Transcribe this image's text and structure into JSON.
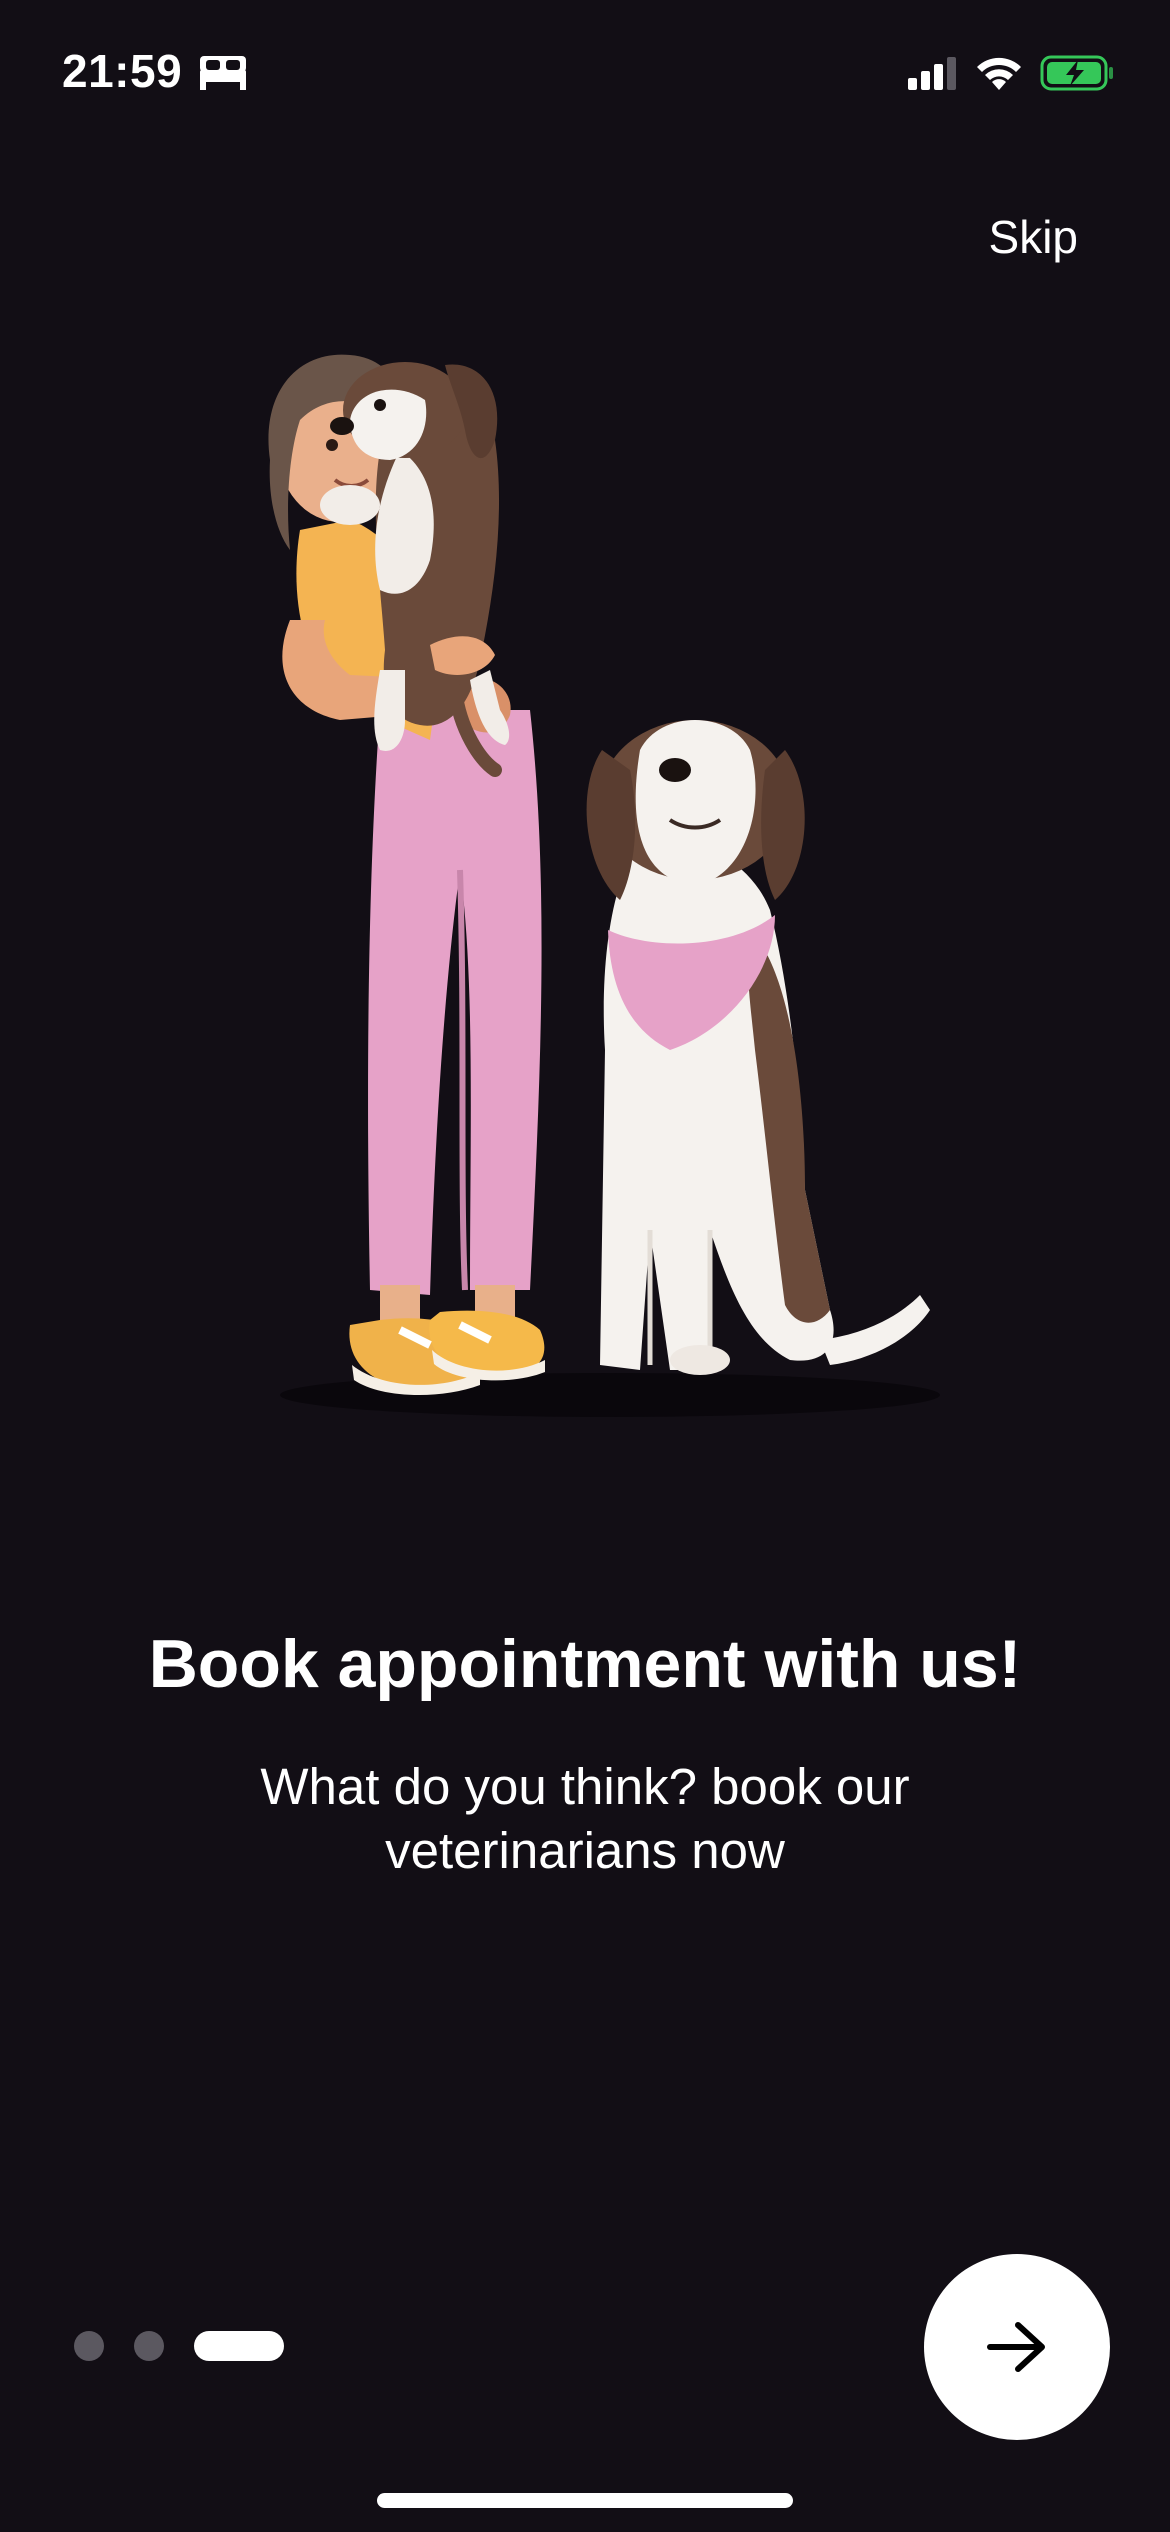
{
  "status_bar": {
    "time": "21:59",
    "icons": [
      "bed-icon",
      "cellular-signal-icon",
      "wifi-icon",
      "battery-charging-icon"
    ],
    "battery_color": "#35c759"
  },
  "header": {
    "skip_label": "Skip"
  },
  "illustration": {
    "name": "woman-holding-dog-with-sitting-dog-illustration"
  },
  "content": {
    "title": "Book appointment with us!",
    "subtitle": "What do you think? book our veterinarians now"
  },
  "pager": {
    "total": 3,
    "current": 3
  },
  "next_button": {
    "icon": "arrow-right-icon"
  },
  "colors": {
    "background": "#120e15",
    "text": "#ffffff",
    "dot_inactive": "#5b5860",
    "dot_active": "#ffffff"
  }
}
